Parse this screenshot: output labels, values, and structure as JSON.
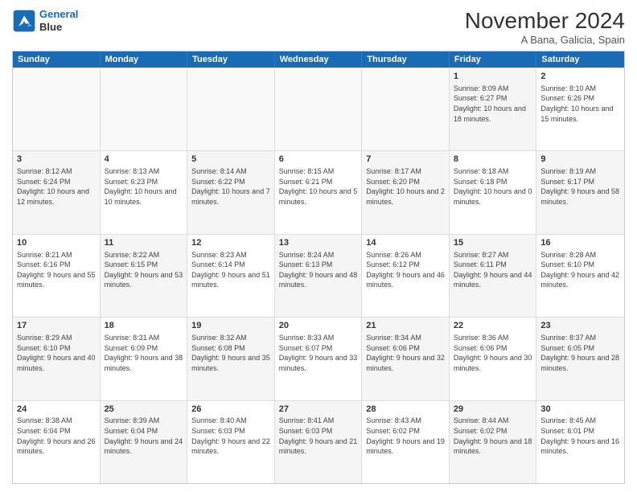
{
  "logo": {
    "line1": "General",
    "line2": "Blue"
  },
  "title": "November 2024",
  "subtitle": "A Bana, Galicia, Spain",
  "days": [
    "Sunday",
    "Monday",
    "Tuesday",
    "Wednesday",
    "Thursday",
    "Friday",
    "Saturday"
  ],
  "rows": [
    [
      {
        "day": "",
        "info": "",
        "empty": true
      },
      {
        "day": "",
        "info": "",
        "empty": true
      },
      {
        "day": "",
        "info": "",
        "empty": true
      },
      {
        "day": "",
        "info": "",
        "empty": true
      },
      {
        "day": "",
        "info": "",
        "empty": true
      },
      {
        "day": "1",
        "info": "Sunrise: 8:09 AM\nSunset: 6:27 PM\nDaylight: 10 hours and 18 minutes.",
        "shaded": true
      },
      {
        "day": "2",
        "info": "Sunrise: 8:10 AM\nSunset: 6:26 PM\nDaylight: 10 hours and 15 minutes.",
        "shaded": false
      }
    ],
    [
      {
        "day": "3",
        "info": "Sunrise: 8:12 AM\nSunset: 6:24 PM\nDaylight: 10 hours and 12 minutes.",
        "shaded": true
      },
      {
        "day": "4",
        "info": "Sunrise: 8:13 AM\nSunset: 6:23 PM\nDaylight: 10 hours and 10 minutes.",
        "shaded": false
      },
      {
        "day": "5",
        "info": "Sunrise: 8:14 AM\nSunset: 6:22 PM\nDaylight: 10 hours and 7 minutes.",
        "shaded": true
      },
      {
        "day": "6",
        "info": "Sunrise: 8:15 AM\nSunset: 6:21 PM\nDaylight: 10 hours and 5 minutes.",
        "shaded": false
      },
      {
        "day": "7",
        "info": "Sunrise: 8:17 AM\nSunset: 6:20 PM\nDaylight: 10 hours and 2 minutes.",
        "shaded": true
      },
      {
        "day": "8",
        "info": "Sunrise: 8:18 AM\nSunset: 6:18 PM\nDaylight: 10 hours and 0 minutes.",
        "shaded": false
      },
      {
        "day": "9",
        "info": "Sunrise: 8:19 AM\nSunset: 6:17 PM\nDaylight: 9 hours and 58 minutes.",
        "shaded": true
      }
    ],
    [
      {
        "day": "10",
        "info": "Sunrise: 8:21 AM\nSunset: 6:16 PM\nDaylight: 9 hours and 55 minutes.",
        "shaded": false
      },
      {
        "day": "11",
        "info": "Sunrise: 8:22 AM\nSunset: 6:15 PM\nDaylight: 9 hours and 53 minutes.",
        "shaded": true
      },
      {
        "day": "12",
        "info": "Sunrise: 8:23 AM\nSunset: 6:14 PM\nDaylight: 9 hours and 51 minutes.",
        "shaded": false
      },
      {
        "day": "13",
        "info": "Sunrise: 8:24 AM\nSunset: 6:13 PM\nDaylight: 9 hours and 48 minutes.",
        "shaded": true
      },
      {
        "day": "14",
        "info": "Sunrise: 8:26 AM\nSunset: 6:12 PM\nDaylight: 9 hours and 46 minutes.",
        "shaded": false
      },
      {
        "day": "15",
        "info": "Sunrise: 8:27 AM\nSunset: 6:11 PM\nDaylight: 9 hours and 44 minutes.",
        "shaded": true
      },
      {
        "day": "16",
        "info": "Sunrise: 8:28 AM\nSunset: 6:10 PM\nDaylight: 9 hours and 42 minutes.",
        "shaded": false
      }
    ],
    [
      {
        "day": "17",
        "info": "Sunrise: 8:29 AM\nSunset: 6:10 PM\nDaylight: 9 hours and 40 minutes.",
        "shaded": true
      },
      {
        "day": "18",
        "info": "Sunrise: 8:31 AM\nSunset: 6:09 PM\nDaylight: 9 hours and 38 minutes.",
        "shaded": false
      },
      {
        "day": "19",
        "info": "Sunrise: 8:32 AM\nSunset: 6:08 PM\nDaylight: 9 hours and 35 minutes.",
        "shaded": true
      },
      {
        "day": "20",
        "info": "Sunrise: 8:33 AM\nSunset: 6:07 PM\nDaylight: 9 hours and 33 minutes.",
        "shaded": false
      },
      {
        "day": "21",
        "info": "Sunrise: 8:34 AM\nSunset: 6:06 PM\nDaylight: 9 hours and 32 minutes.",
        "shaded": true
      },
      {
        "day": "22",
        "info": "Sunrise: 8:36 AM\nSunset: 6:06 PM\nDaylight: 9 hours and 30 minutes.",
        "shaded": false
      },
      {
        "day": "23",
        "info": "Sunrise: 8:37 AM\nSunset: 6:05 PM\nDaylight: 9 hours and 28 minutes.",
        "shaded": true
      }
    ],
    [
      {
        "day": "24",
        "info": "Sunrise: 8:38 AM\nSunset: 6:04 PM\nDaylight: 9 hours and 26 minutes.",
        "shaded": false
      },
      {
        "day": "25",
        "info": "Sunrise: 8:39 AM\nSunset: 6:04 PM\nDaylight: 9 hours and 24 minutes.",
        "shaded": true
      },
      {
        "day": "26",
        "info": "Sunrise: 8:40 AM\nSunset: 6:03 PM\nDaylight: 9 hours and 22 minutes.",
        "shaded": false
      },
      {
        "day": "27",
        "info": "Sunrise: 8:41 AM\nSunset: 6:03 PM\nDaylight: 9 hours and 21 minutes.",
        "shaded": true
      },
      {
        "day": "28",
        "info": "Sunrise: 8:43 AM\nSunset: 6:02 PM\nDaylight: 9 hours and 19 minutes.",
        "shaded": false
      },
      {
        "day": "29",
        "info": "Sunrise: 8:44 AM\nSunset: 6:02 PM\nDaylight: 9 hours and 18 minutes.",
        "shaded": true
      },
      {
        "day": "30",
        "info": "Sunrise: 8:45 AM\nSunset: 6:01 PM\nDaylight: 9 hours and 16 minutes.",
        "shaded": false
      }
    ]
  ]
}
